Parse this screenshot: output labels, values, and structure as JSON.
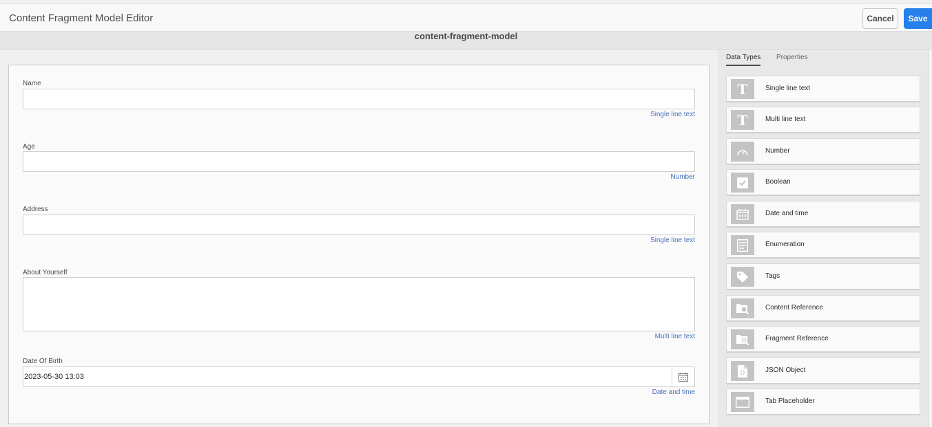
{
  "header": {
    "title": "Content Fragment Model Editor",
    "cancel_label": "Cancel",
    "save_label": "Save"
  },
  "model_name": "content-fragment-model",
  "form": {
    "fields": [
      {
        "label": "Name",
        "type": "Single line text",
        "value": ""
      },
      {
        "label": "Age",
        "type": "Number",
        "value": ""
      },
      {
        "label": "Address",
        "type": "Single line text",
        "value": ""
      },
      {
        "label": "About Yourself",
        "type": "Multi line text",
        "value": ""
      },
      {
        "label": "Date Of Birth",
        "type": "Date and time",
        "value": "2023-05-30 13:03"
      }
    ]
  },
  "sidebar": {
    "tabs": [
      {
        "label": "Data Types",
        "active": true
      },
      {
        "label": "Properties",
        "active": false
      }
    ],
    "data_types": [
      {
        "label": "Single line text",
        "icon": "text-icon"
      },
      {
        "label": "Multi line text",
        "icon": "text-icon"
      },
      {
        "label": "Number",
        "icon": "gauge-icon"
      },
      {
        "label": "Boolean",
        "icon": "checkbox-icon"
      },
      {
        "label": "Date and time",
        "icon": "calendar-icon"
      },
      {
        "label": "Enumeration",
        "icon": "list-icon"
      },
      {
        "label": "Tags",
        "icon": "tag-icon"
      },
      {
        "label": "Content Reference",
        "icon": "folder-search-icon"
      },
      {
        "label": "Fragment Reference",
        "icon": "folder-search-icon"
      },
      {
        "label": "JSON Object",
        "icon": "json-file-icon"
      },
      {
        "label": "Tab Placeholder",
        "icon": "tab-icon"
      }
    ]
  },
  "colors": {
    "accent": "#2680eb",
    "type_link": "#4670b8",
    "icon_tile": "#c4c4c4"
  }
}
